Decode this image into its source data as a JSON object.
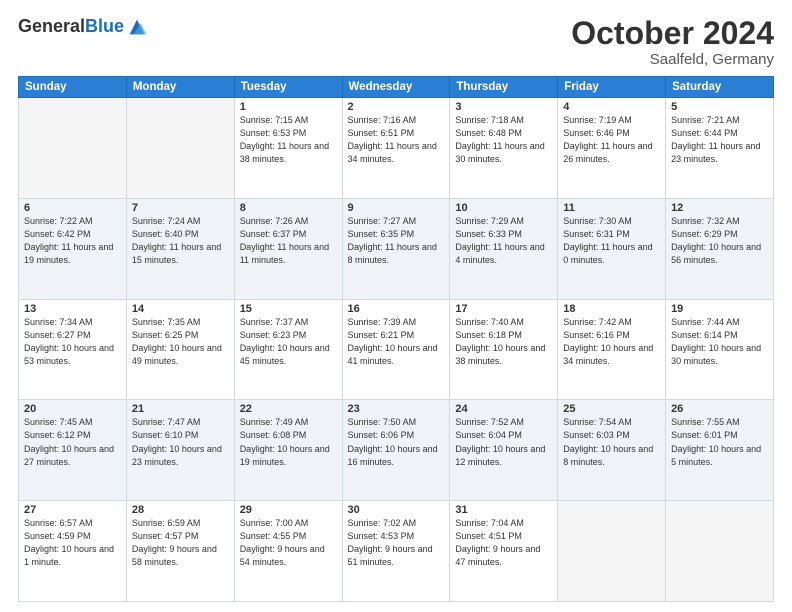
{
  "header": {
    "logo_line1": "General",
    "logo_line2": "Blue",
    "month": "October 2024",
    "location": "Saalfeld, Germany"
  },
  "weekdays": [
    "Sunday",
    "Monday",
    "Tuesday",
    "Wednesday",
    "Thursday",
    "Friday",
    "Saturday"
  ],
  "weeks": [
    [
      {
        "day": "",
        "info": ""
      },
      {
        "day": "",
        "info": ""
      },
      {
        "day": "1",
        "info": "Sunrise: 7:15 AM\nSunset: 6:53 PM\nDaylight: 11 hours and 38 minutes."
      },
      {
        "day": "2",
        "info": "Sunrise: 7:16 AM\nSunset: 6:51 PM\nDaylight: 11 hours and 34 minutes."
      },
      {
        "day": "3",
        "info": "Sunrise: 7:18 AM\nSunset: 6:48 PM\nDaylight: 11 hours and 30 minutes."
      },
      {
        "day": "4",
        "info": "Sunrise: 7:19 AM\nSunset: 6:46 PM\nDaylight: 11 hours and 26 minutes."
      },
      {
        "day": "5",
        "info": "Sunrise: 7:21 AM\nSunset: 6:44 PM\nDaylight: 11 hours and 23 minutes."
      }
    ],
    [
      {
        "day": "6",
        "info": "Sunrise: 7:22 AM\nSunset: 6:42 PM\nDaylight: 11 hours and 19 minutes."
      },
      {
        "day": "7",
        "info": "Sunrise: 7:24 AM\nSunset: 6:40 PM\nDaylight: 11 hours and 15 minutes."
      },
      {
        "day": "8",
        "info": "Sunrise: 7:26 AM\nSunset: 6:37 PM\nDaylight: 11 hours and 11 minutes."
      },
      {
        "day": "9",
        "info": "Sunrise: 7:27 AM\nSunset: 6:35 PM\nDaylight: 11 hours and 8 minutes."
      },
      {
        "day": "10",
        "info": "Sunrise: 7:29 AM\nSunset: 6:33 PM\nDaylight: 11 hours and 4 minutes."
      },
      {
        "day": "11",
        "info": "Sunrise: 7:30 AM\nSunset: 6:31 PM\nDaylight: 11 hours and 0 minutes."
      },
      {
        "day": "12",
        "info": "Sunrise: 7:32 AM\nSunset: 6:29 PM\nDaylight: 10 hours and 56 minutes."
      }
    ],
    [
      {
        "day": "13",
        "info": "Sunrise: 7:34 AM\nSunset: 6:27 PM\nDaylight: 10 hours and 53 minutes."
      },
      {
        "day": "14",
        "info": "Sunrise: 7:35 AM\nSunset: 6:25 PM\nDaylight: 10 hours and 49 minutes."
      },
      {
        "day": "15",
        "info": "Sunrise: 7:37 AM\nSunset: 6:23 PM\nDaylight: 10 hours and 45 minutes."
      },
      {
        "day": "16",
        "info": "Sunrise: 7:39 AM\nSunset: 6:21 PM\nDaylight: 10 hours and 41 minutes."
      },
      {
        "day": "17",
        "info": "Sunrise: 7:40 AM\nSunset: 6:18 PM\nDaylight: 10 hours and 38 minutes."
      },
      {
        "day": "18",
        "info": "Sunrise: 7:42 AM\nSunset: 6:16 PM\nDaylight: 10 hours and 34 minutes."
      },
      {
        "day": "19",
        "info": "Sunrise: 7:44 AM\nSunset: 6:14 PM\nDaylight: 10 hours and 30 minutes."
      }
    ],
    [
      {
        "day": "20",
        "info": "Sunrise: 7:45 AM\nSunset: 6:12 PM\nDaylight: 10 hours and 27 minutes."
      },
      {
        "day": "21",
        "info": "Sunrise: 7:47 AM\nSunset: 6:10 PM\nDaylight: 10 hours and 23 minutes."
      },
      {
        "day": "22",
        "info": "Sunrise: 7:49 AM\nSunset: 6:08 PM\nDaylight: 10 hours and 19 minutes."
      },
      {
        "day": "23",
        "info": "Sunrise: 7:50 AM\nSunset: 6:06 PM\nDaylight: 10 hours and 16 minutes."
      },
      {
        "day": "24",
        "info": "Sunrise: 7:52 AM\nSunset: 6:04 PM\nDaylight: 10 hours and 12 minutes."
      },
      {
        "day": "25",
        "info": "Sunrise: 7:54 AM\nSunset: 6:03 PM\nDaylight: 10 hours and 8 minutes."
      },
      {
        "day": "26",
        "info": "Sunrise: 7:55 AM\nSunset: 6:01 PM\nDaylight: 10 hours and 5 minutes."
      }
    ],
    [
      {
        "day": "27",
        "info": "Sunrise: 6:57 AM\nSunset: 4:59 PM\nDaylight: 10 hours and 1 minute."
      },
      {
        "day": "28",
        "info": "Sunrise: 6:59 AM\nSunset: 4:57 PM\nDaylight: 9 hours and 58 minutes."
      },
      {
        "day": "29",
        "info": "Sunrise: 7:00 AM\nSunset: 4:55 PM\nDaylight: 9 hours and 54 minutes."
      },
      {
        "day": "30",
        "info": "Sunrise: 7:02 AM\nSunset: 4:53 PM\nDaylight: 9 hours and 51 minutes."
      },
      {
        "day": "31",
        "info": "Sunrise: 7:04 AM\nSunset: 4:51 PM\nDaylight: 9 hours and 47 minutes."
      },
      {
        "day": "",
        "info": ""
      },
      {
        "day": "",
        "info": ""
      }
    ]
  ]
}
